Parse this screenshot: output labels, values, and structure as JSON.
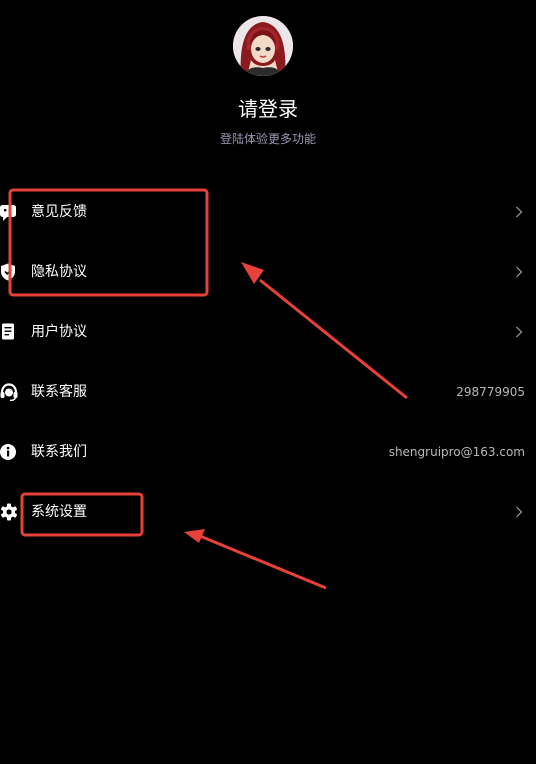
{
  "profile": {
    "title": "请登录",
    "subtitle": "登陆体验更多功能",
    "avatar_icon": "avatar-illustration"
  },
  "menu": {
    "items": [
      {
        "label": "意见反馈",
        "icon": "feedback-icon",
        "value": "",
        "chevron": true
      },
      {
        "label": "隐私协议",
        "icon": "shield-icon",
        "value": "",
        "chevron": true
      },
      {
        "label": "用户协议",
        "icon": "document-icon",
        "value": "",
        "chevron": true
      },
      {
        "label": "联系客服",
        "icon": "headset-icon",
        "value": "298779905",
        "chevron": false
      },
      {
        "label": "联系我们",
        "icon": "info-icon",
        "value": "shengruipro@163.com",
        "chevron": false
      },
      {
        "label": "系统设置",
        "icon": "gear-icon",
        "value": "",
        "chevron": true
      }
    ]
  },
  "colors": {
    "background": "#000000",
    "text": "#ffffff",
    "subtitle": "#9a98b0",
    "value_text": "#b8b8b8",
    "chevron": "#8a8a8a",
    "annotation_red": "#e8413a"
  }
}
